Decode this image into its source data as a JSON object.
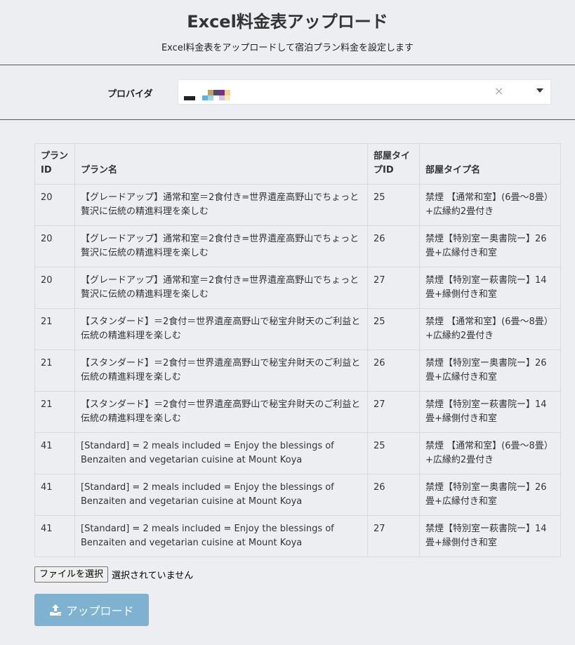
{
  "header": {
    "title": "Excel料金表アップロード",
    "subtitle": "Excel料金表をアップロードして宿泊プラン料金を設定します"
  },
  "provider": {
    "label": "プロバイダ",
    "clear_glyph": "×",
    "logo_colors": [
      "#222222",
      "#5fb3d6",
      "#7a2f8f",
      "#c0a060",
      "#f4d58a"
    ]
  },
  "table": {
    "headers": [
      "プランID",
      "プラン名",
      "部屋タイプID",
      "部屋タイプ名"
    ],
    "rows": [
      [
        "20",
        "【グレードアップ】通常和室＝2食付き=世界遺産高野山でちょっと贅沢に伝統の精進料理を楽しむ",
        "25",
        "禁煙 【通常和室】(6畳〜8畳）+広縁約2畳付き"
      ],
      [
        "20",
        "【グレードアップ】通常和室＝2食付き=世界遺産高野山でちょっと贅沢に伝統の精進料理を楽しむ",
        "26",
        "禁煙【特別室ー奥書院ー】26畳+広縁付き和室"
      ],
      [
        "20",
        "【グレードアップ】通常和室＝2食付き=世界遺産高野山でちょっと贅沢に伝統の精進料理を楽しむ",
        "27",
        "禁煙【特別室ー萩書院ー】14畳+縁側付き和室"
      ],
      [
        "21",
        "【スタンダード】＝2食付＝世界遺産高野山で秘宝弁財天のご利益と伝統の精進料理を楽しむ",
        "25",
        "禁煙 【通常和室】(6畳〜8畳）+広縁約2畳付き"
      ],
      [
        "21",
        "【スタンダード】＝2食付＝世界遺産高野山で秘宝弁財天のご利益と伝統の精進料理を楽しむ",
        "26",
        "禁煙【特別室ー奥書院ー】26畳+広縁付き和室"
      ],
      [
        "21",
        "【スタンダード】＝2食付＝世界遺産高野山で秘宝弁財天のご利益と伝統の精進料理を楽しむ",
        "27",
        "禁煙【特別室ー萩書院ー】14畳+縁側付き和室"
      ],
      [
        "41",
        "[Standard] = 2 meals included = Enjoy the blessings of Benzaiten and vegetarian cuisine at Mount Koya",
        "25",
        "禁煙 【通常和室】(6畳〜8畳）+広縁約2畳付き"
      ],
      [
        "41",
        "[Standard] = 2 meals included = Enjoy the blessings of Benzaiten and vegetarian cuisine at Mount Koya",
        "26",
        "禁煙【特別室ー奥書院ー】26畳+広縁付き和室"
      ],
      [
        "41",
        "[Standard] = 2 meals included = Enjoy the blessings of Benzaiten and vegetarian cuisine at Mount Koya",
        "27",
        "禁煙【特別室ー萩書院ー】14畳+縁側付き和室"
      ]
    ]
  },
  "file_input": {
    "button_label": "ファイルを選択",
    "status": "選択されていません"
  },
  "upload": {
    "label": "アップロード",
    "icon": "upload-icon",
    "color": "#7fb1d1"
  }
}
